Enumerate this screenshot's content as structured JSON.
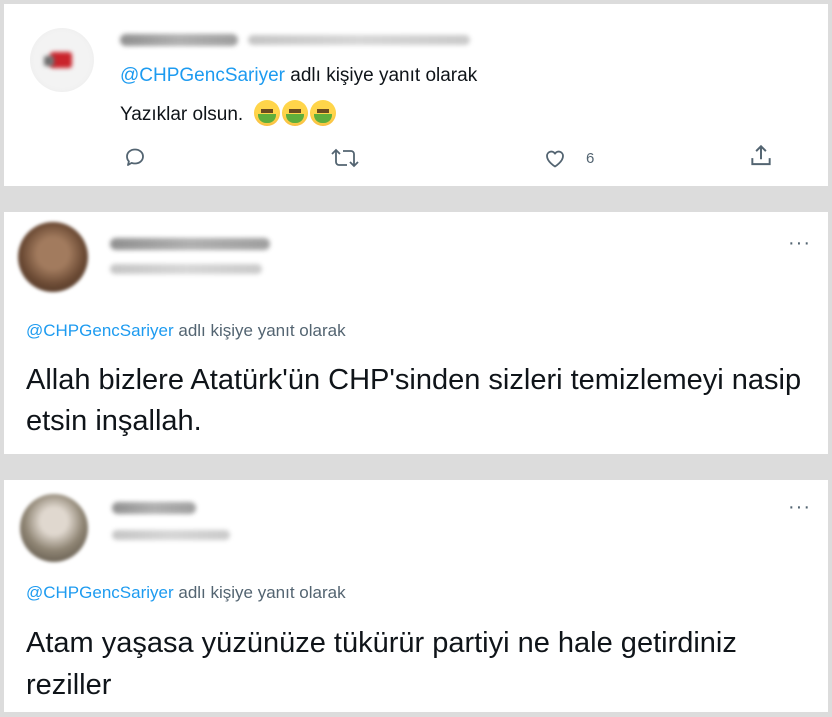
{
  "reply_prefix": "@CHPGencSariyer",
  "reply_suffix": " adlı kişiye yanıt olarak",
  "tweets": [
    {
      "text": "Yazıklar olsun.",
      "emoji": [
        "nauseated-face-emoji",
        "nauseated-face-emoji",
        "nauseated-face-emoji"
      ],
      "like_count": "6"
    },
    {
      "text": "Allah bizlere Atatürk'ün CHP'sinden sizleri temizlemeyi nasip etsin inşallah.",
      "more": "···"
    },
    {
      "text": "Atam yaşasa yüzünüze tükürür partiyi ne hale getirdiniz reziller",
      "more": "···"
    }
  ],
  "icons": {
    "reply": "reply-icon",
    "retweet": "retweet-icon",
    "like": "heart-icon",
    "share": "share-icon"
  },
  "colors": {
    "mention": "#1d9bf0",
    "secondary_text": "#536471",
    "primary_text": "#0f1419",
    "separator": "#dcdcdc"
  }
}
